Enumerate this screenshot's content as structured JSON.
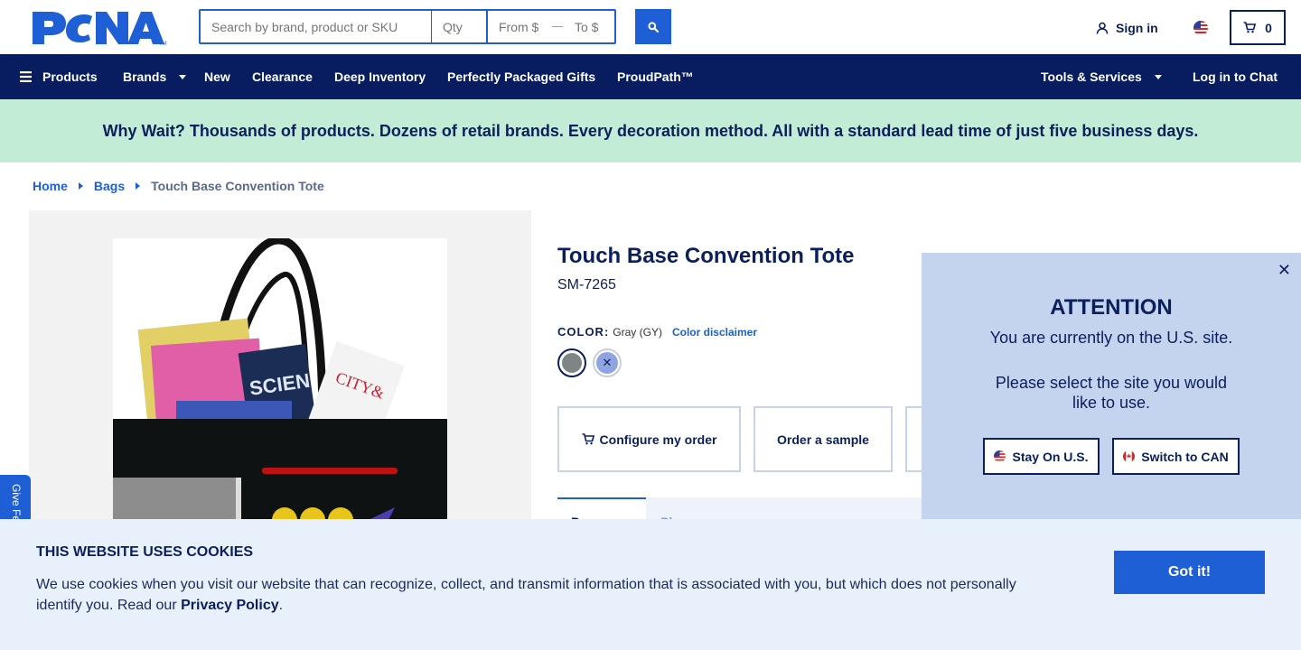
{
  "header": {
    "logo_text": "PCNA",
    "search": {
      "placeholder": "Search by brand, product or SKU",
      "qty_placeholder": "Qty",
      "from_placeholder": "From $",
      "to_placeholder": "To $"
    },
    "sign_in_label": "Sign in",
    "cart_count": "0"
  },
  "nav": {
    "products_label": "Products",
    "items": [
      "Brands",
      "New",
      "Clearance",
      "Deep Inventory",
      "Perfectly Packaged Gifts",
      "ProudPath™"
    ],
    "tools_label": "Tools & Services",
    "chat_label": "Log in to Chat"
  },
  "promo": {
    "text": "Why Wait? Thousands of products. Dozens of retail brands. Every decoration method. All with a standard lead time of just five business days."
  },
  "breadcrumb": {
    "items": [
      "Home",
      "Bags"
    ],
    "current": "Touch Base Convention Tote"
  },
  "product": {
    "title": "Touch Base Convention Tote",
    "sku": "SM-7265",
    "color_label": "COLOR:",
    "color_value": "Gray (GY)",
    "color_disclaimer": "Color disclaimer",
    "swatches": [
      {
        "name": "Gray",
        "hex": "#7d8585"
      },
      {
        "name": "Royal",
        "hex": "#8fa4e0"
      }
    ],
    "actions": [
      "Configure my order",
      "Order a sample"
    ],
    "tabs": [
      "Pr",
      "Ph"
    ]
  },
  "feedback": {
    "label": "Give Fe"
  },
  "site_modal": {
    "title": "ATTENTION",
    "message1": "You are currently on the U.S. site.",
    "message2": "Please select the site you would like to use.",
    "stay_label": "Stay On U.S.",
    "switch_label": "Switch to CAN"
  },
  "cookie_banner": {
    "title": "THIS WEBSITE USES COOKIES",
    "text": "We use cookies when you visit our website that can recognize, collect, and transmit information that is associated with you, but which does not personally identify you. Read our ",
    "link": "Privacy Policy",
    "end": ".",
    "button": "Got it!"
  },
  "colors": {
    "navy": "#071d5f",
    "accent": "#1f5fd6",
    "promo_bg": "#c3ecd7",
    "modal_bg": "#c4d4ef",
    "cookie_bg": "#e8f0fc"
  }
}
